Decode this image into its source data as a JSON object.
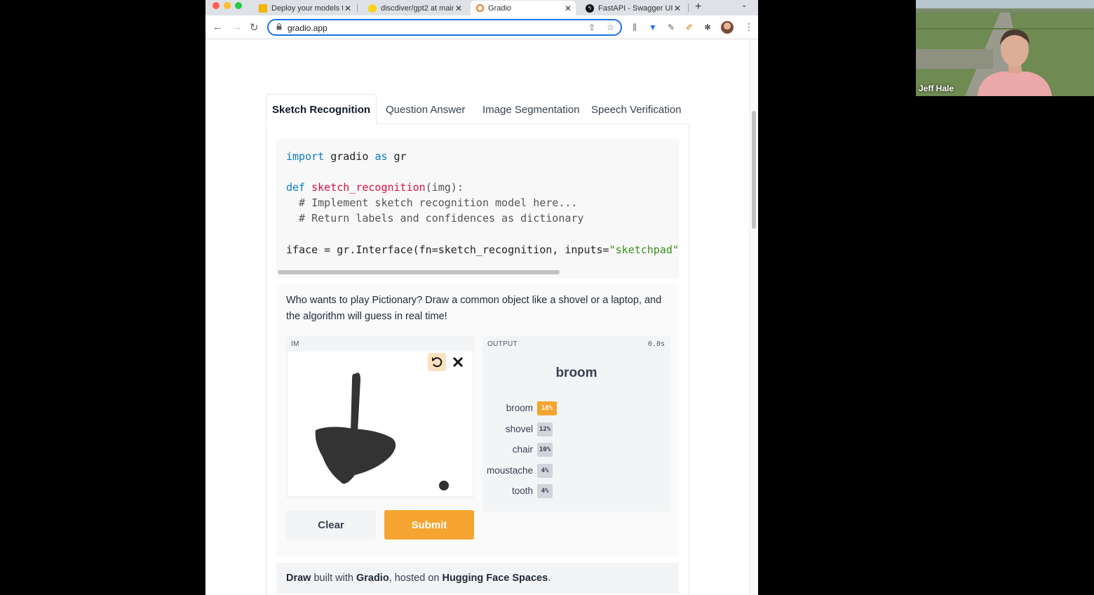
{
  "browser": {
    "tabs": [
      {
        "title": "Deploy your models t",
        "icon": "slides-icon",
        "color": "#f4b400"
      },
      {
        "title": "discdiver/gpt2 at main",
        "icon": "huggingface-icon",
        "color": "#ffd21e"
      },
      {
        "title": "Gradio",
        "icon": "gradio-icon",
        "color": "#f97316"
      },
      {
        "title": "FastAPI - Swagger UI",
        "icon": "fastapi-icon",
        "color": "#111111"
      }
    ],
    "url": "gradio.app"
  },
  "demo_tabs": [
    "Sketch Recognition",
    "Question Answer",
    "Image Segmentation",
    "Speech Verification"
  ],
  "code": {
    "l1_import": "import",
    "l1_mod": " gradio ",
    "l1_as": "as",
    "l1_alias": " gr",
    "l2_def": "def",
    "l2_fn": " sketch_recognition",
    "l2_args": "(img):",
    "l3": "  # Implement sketch recognition model here...",
    "l4": "  # Return labels and confidences as dictionary",
    "l5_a": "iface = gr.Interface(fn=sketch_recognition, inputs=",
    "l5_str": "\"sketchpad\"",
    "l5_b": ","
  },
  "description": "Who wants to play Pictionary? Draw a common object like a shovel or a laptop, and the algorithm will guess in real time!",
  "input": {
    "label": "IM"
  },
  "output": {
    "label": "OUTPUT",
    "time": "0.0s",
    "top_label": "broom",
    "confidences": [
      {
        "label": "broom",
        "value": "18%",
        "fraction": 0.18
      },
      {
        "label": "shovel",
        "value": "12%",
        "fraction": 0.12
      },
      {
        "label": "chair",
        "value": "10%",
        "fraction": 0.1
      },
      {
        "label": "moustache",
        "value": "4%",
        "fraction": 0.04
      },
      {
        "label": "tooth",
        "value": "4%",
        "fraction": 0.04
      }
    ]
  },
  "buttons": {
    "clear": "Clear",
    "submit": "Submit"
  },
  "footer": {
    "app": "Draw",
    "t1": " built with ",
    "gradio": "Gradio",
    "t2": ", hosted on ",
    "spaces": "Hugging Face Spaces",
    "t3": "."
  },
  "webcam": {
    "name": "Jeff Hale"
  },
  "colors": {
    "accent": "#f6a431",
    "link_blue": "#1a73e8"
  }
}
